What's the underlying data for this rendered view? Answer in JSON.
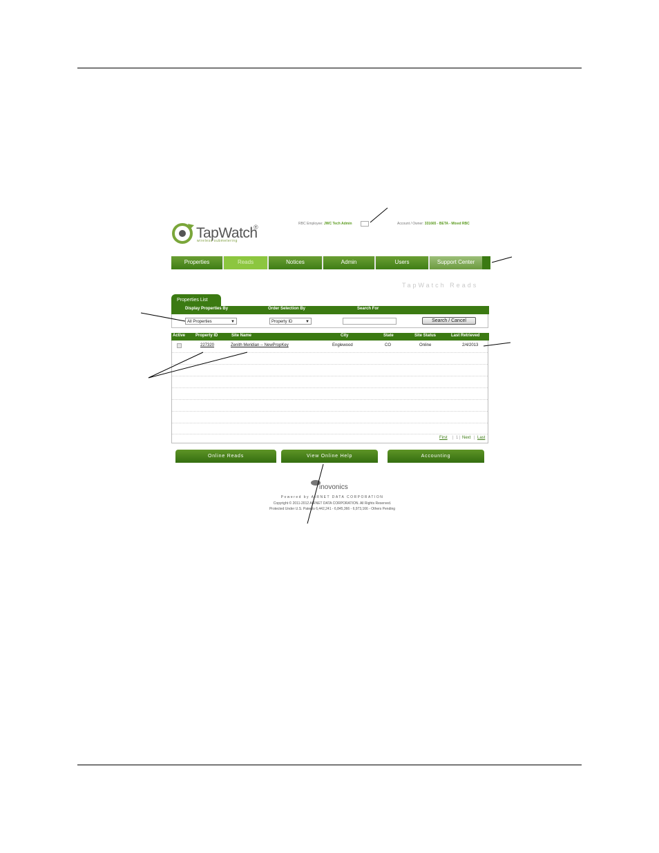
{
  "brand": {
    "name": "TapWatch",
    "registered": "®",
    "tagline": "wireless submetering"
  },
  "header": {
    "employee_label": "RBC Employee:",
    "employee_name": "JWC Tech Admin",
    "account_label": "Account / Owner:",
    "account_value": "331665 - BETA - Mixed RBC"
  },
  "nav": {
    "items": [
      {
        "label": "Properties"
      },
      {
        "label": "Reads"
      },
      {
        "label": "Notices"
      },
      {
        "label": "Admin"
      },
      {
        "label": "Users"
      },
      {
        "label": "Support Center"
      }
    ],
    "active": "Reads"
  },
  "page_heading": "TapWatch Reads",
  "tab": {
    "label": "Properties List"
  },
  "filters": {
    "display_label": "Display Properties By",
    "display_value": "All Properties",
    "order_label": "Order Selection By",
    "order_value": "Property ID",
    "search_label": "Search For",
    "search_value": "",
    "search_button": "Search / Cancel"
  },
  "table": {
    "columns": [
      "Active",
      "Property ID",
      "Site Name",
      "City",
      "State",
      "Site Status",
      "Last Retrieved"
    ],
    "rows": [
      {
        "active": true,
        "property_id": "227320",
        "site_name": "Zenith Meridian -- NewPropKey",
        "city": "Englewood",
        "state": "CO",
        "site_status": "Online",
        "last_retrieved": "2/4/2013"
      }
    ]
  },
  "pager": {
    "first": "First",
    "page": "1",
    "next": "Next",
    "last": "Last"
  },
  "buttons": {
    "online_reads": "Online Reads",
    "view_help": "View Online Help",
    "accounting": "Accounting"
  },
  "footer": {
    "partner": "inovonics",
    "powered_by": "Powered by AIRNET DATA CORPORATION",
    "copyright": "Copyright © 2011-2012 AIRNET DATA CORPORATION. All Rights Reserved.",
    "patents": "Protected Under U.S. Patents 6,442,241 - 6,845,366 - 6,973,166 - Others Pending"
  },
  "colors": {
    "nav_green": "#3b7a12",
    "active_tab": "#8cc63f",
    "link_green": "#5a9a1e"
  }
}
